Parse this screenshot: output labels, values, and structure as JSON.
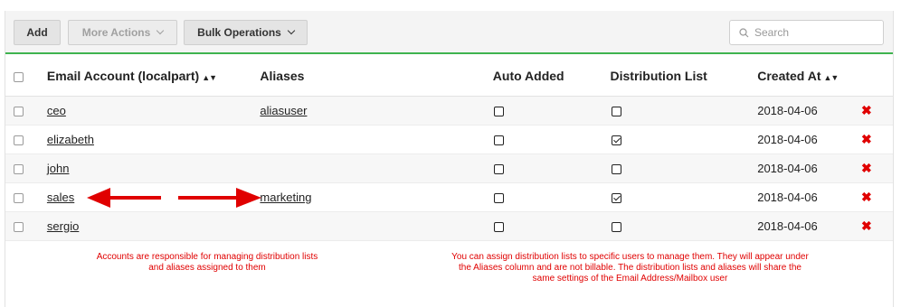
{
  "toolbar": {
    "add_label": "Add",
    "more_actions_label": "More Actions",
    "bulk_operations_label": "Bulk Operations",
    "search_placeholder": "Search",
    "accent_color": "#3fb34f"
  },
  "table": {
    "columns": [
      "Email Account (localpart)",
      "Aliases",
      "Auto Added",
      "Distribution List",
      "Created At"
    ],
    "sortable": [
      "Email Account (localpart)",
      "Created At"
    ],
    "rows": [
      {
        "account": "ceo",
        "alias": "aliasuser",
        "auto_added": false,
        "distribution_list": false,
        "created_at": "2018-04-06"
      },
      {
        "account": "elizabeth",
        "alias": "",
        "auto_added": false,
        "distribution_list": true,
        "created_at": "2018-04-06"
      },
      {
        "account": "john",
        "alias": "",
        "auto_added": false,
        "distribution_list": false,
        "created_at": "2018-04-06"
      },
      {
        "account": "sales",
        "alias": "marketing",
        "auto_added": false,
        "distribution_list": true,
        "created_at": "2018-04-06"
      },
      {
        "account": "sergio",
        "alias": "",
        "auto_added": false,
        "distribution_list": false,
        "created_at": "2018-04-06"
      }
    ]
  },
  "annotations": {
    "left_note": "Accounts are responsible for managing distribution lists and aliases assigned to them",
    "right_note": "You can assign distribution lists to specific users to manage them. They will appear under the Aliases column and are not billable. The distribution lists and aliases will share the same settings of the Email Address/Mailbox user",
    "color": "#e00000"
  },
  "icons": {
    "delete": "delete-x-icon",
    "sort": "sort-arrows-icon",
    "search": "search-icon"
  }
}
